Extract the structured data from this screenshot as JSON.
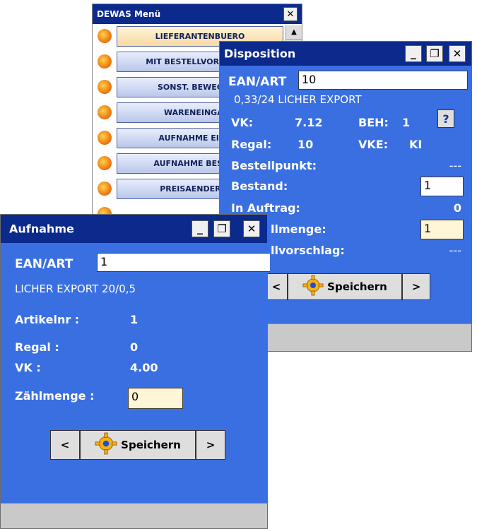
{
  "menu": {
    "title": "DEWAS Menü",
    "items": [
      {
        "label": "LIEFERANTENBUERO"
      },
      {
        "label": "MIT BESTELLVORSCHLAG"
      },
      {
        "label": "SONST. BEWEGUNG"
      },
      {
        "label": "WARENEINGANG"
      },
      {
        "label": "AUFNAHME EINZEL"
      },
      {
        "label": "AUFNAHME BESTAND"
      },
      {
        "label": "PREISAENDERUNG"
      }
    ]
  },
  "disposition": {
    "title": "Disposition",
    "ean_label": "EAN/ART",
    "ean_value": "10",
    "article_desc": "0,33/24 LICHER EXPORT",
    "vk_label": "VK:",
    "vk_value": "7.12",
    "beh_label": "BEH:",
    "beh_value": "1",
    "help_label": "?",
    "regal_label": "Regal:",
    "regal_value": "10",
    "vke_label": "VKE:",
    "vke_value": "KI",
    "bestellpunkt_label": "Bestellpunkt:",
    "bestellpunkt_value": "---",
    "bestand_label": "Bestand:",
    "bestand_value": "1",
    "inauftrag_label": "In Auftrag:",
    "inauftrag_value": "0",
    "bestellmenge_label": "llmenge:",
    "bestellmenge_value": "1",
    "bestellvorschlag_label": "llvorschlag:",
    "bestellvorschlag_value": "---",
    "prev_label": "<",
    "save_label": "Speichern",
    "next_label": ">"
  },
  "aufnahme": {
    "title": "Aufnahme",
    "ean_label": "EAN/ART",
    "ean_value": "1",
    "article_desc": "LICHER EXPORT 20/0,5",
    "artikelnr_label": "Artikelnr :",
    "artikelnr_value": "1",
    "regal_label": "Regal :",
    "regal_value": "0",
    "vk_label": "VK :",
    "vk_value": "4.00",
    "zaehlmenge_label": "Zählmenge :",
    "zaehlmenge_value": "0",
    "prev_label": "<",
    "save_label": "Speichern",
    "next_label": ">"
  }
}
